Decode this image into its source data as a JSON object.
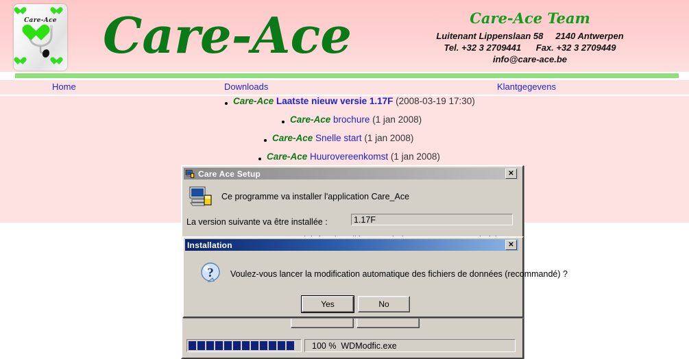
{
  "site": {
    "logo": {
      "card_text": "Care-Ace",
      "icon": "playing-card-stethoscope-heart-logo"
    },
    "title": "Care-Ace",
    "team_title": "Care-Ace Team",
    "address_lines": "Luitenant Lippenslaan 58     2140 Antwerpen\nTel. +32 3 2709441      Fax. +32 3 2709449\ninfo@care-ace.be",
    "colors": {
      "header_pink": "#ffc8c8",
      "band_pink": "#fde2e1",
      "green_bar": "#8ede7b",
      "brand_green": "#0a7a18",
      "link_blue": "#2222cc"
    },
    "nav": [
      {
        "label": "Home"
      },
      {
        "label": "Downloads"
      },
      {
        "label": "Klantgegevens"
      }
    ],
    "downloads": [
      {
        "brand": "Care-Ace",
        "link": "Laatste nieuw versie 1.17F",
        "bold": true,
        "date": "(2008-03-19 17:30)"
      },
      {
        "brand": "Care-Ace",
        "link": "brochure",
        "bold": false,
        "date": "(1 jan 2008)"
      },
      {
        "brand": "Care-Ace",
        "link": "Snelle start",
        "bold": false,
        "date": "(1 jan 2008)"
      },
      {
        "brand": "Care-Ace",
        "link": "Huurovereenkomst",
        "bold": false,
        "date": "(1 jan 2008)"
      }
    ]
  },
  "setup_window": {
    "title": "Care Ace Setup",
    "title_icon": "setup-computer-icon",
    "close_label": "✕",
    "body_icon": "computer-install-icon",
    "intro_text": "Ce programme va installer l'application Care_Ace",
    "version_label": "La version suivante va être installée :",
    "version_value": "1.17F",
    "warning_text": "ATTENTION : Ce programme doit être installé sous Windows. Vous pouvez choisir une autre application destination.",
    "ok_label": "",
    "cancel_label": "",
    "status": {
      "progress_percent": "100 %",
      "progress_blocks": 12,
      "file_name": "WDModfic.exe",
      "text": "100 %  WDModfic.exe"
    }
  },
  "installation_dialog": {
    "title": "Installation",
    "close_label": "✕",
    "icon": "question-mark-icon",
    "message": "Voulez-vous lancer la modification automatique des fichiers de données (recommandé) ?",
    "buttons": [
      {
        "label": "Yes",
        "focused": true
      },
      {
        "label": "No",
        "focused": false
      }
    ]
  }
}
